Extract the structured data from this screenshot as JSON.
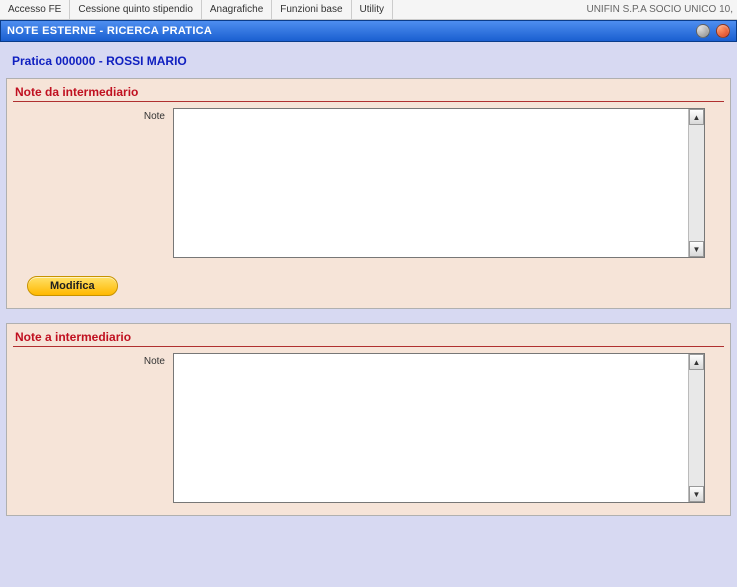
{
  "menubar": {
    "items": [
      "Accesso FE",
      "Cessione quinto stipendio",
      "Anagrafiche",
      "Funzioni base",
      "Utility"
    ],
    "company": "UNIFIN S.P.A SOCIO UNICO  10,"
  },
  "titlebar": {
    "title": "NOTE ESTERNE - RICERCA PRATICA"
  },
  "pratica": {
    "label": "Pratica  000000 - ROSSI MARIO"
  },
  "panels": {
    "da": {
      "title": "Note da intermediario",
      "field_label": "Note",
      "value": "",
      "button_label": "Modifica"
    },
    "a": {
      "title": "Note a intermediario",
      "field_label": "Note",
      "value": ""
    }
  }
}
